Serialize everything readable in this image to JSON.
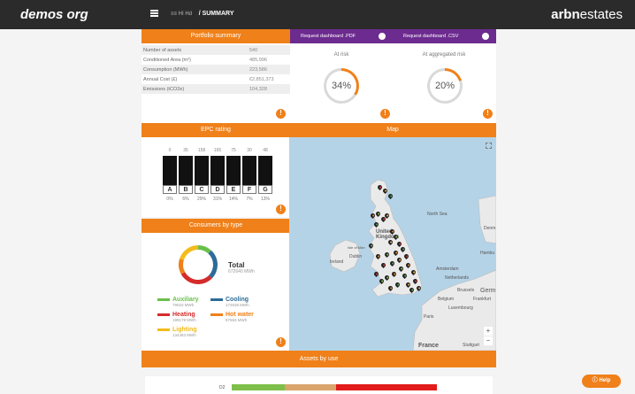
{
  "topbar": {
    "brand": "demos org",
    "crumb_prefix": "≡≡  HI Hd",
    "crumb_current": "/ SUMMARY",
    "logo_bold": "arbn",
    "logo_rest": "estates"
  },
  "portfolio": {
    "title": "Portfolio summary",
    "rows": [
      {
        "label": "Number of assets",
        "value": "540"
      },
      {
        "label": "Conditioned Area (m²)",
        "value": "485,996"
      },
      {
        "label": "Consumption (MWh)",
        "value": "223,586"
      },
      {
        "label": "Annual Cost (£)",
        "value": "€2,851,373"
      },
      {
        "label": "Emissions (tCO2e)",
        "value": "104,328"
      }
    ]
  },
  "request": {
    "pdf_label": "Request dashboard .PDF",
    "csv_label": "Request dashboard .CSV"
  },
  "at_risk": {
    "label": "At risk",
    "percent": 34,
    "percent_text": "34%"
  },
  "aggregated_risk": {
    "label": "At aggregated risk",
    "percent": 20,
    "percent_text": "20%"
  },
  "epc": {
    "title": "EPC rating",
    "bands": [
      {
        "letter": "A",
        "count": "0",
        "pct": "0%",
        "fill": 0.02,
        "color": "#2e8b3a"
      },
      {
        "letter": "B",
        "count": "35",
        "pct": "6%",
        "fill": 0.03,
        "color": "#4caf50"
      },
      {
        "letter": "C",
        "count": "158",
        "pct": "29%",
        "fill": 0.22,
        "color": "#8bc34a"
      },
      {
        "letter": "D",
        "count": "165",
        "pct": "31%",
        "fill": 0.2,
        "color": "#f2e230"
      },
      {
        "letter": "E",
        "count": "75",
        "pct": "14%",
        "fill": 0.1,
        "color": "#f5b945"
      },
      {
        "letter": "F",
        "count": "30",
        "pct": "7%",
        "fill": 0.05,
        "color": "#ef8a2d"
      },
      {
        "letter": "G",
        "count": "48",
        "pct": "13%",
        "fill": 0.1,
        "color": "#e53935"
      }
    ]
  },
  "consumers": {
    "title": "Consumers by type",
    "total_label": "Total",
    "total_value": "672640 MWh",
    "items": [
      {
        "name": "Auxiliary",
        "value": "79023 MWh",
        "color": "#6abf4b"
      },
      {
        "name": "Cooling",
        "value": "172638 MWh",
        "color": "#2d6b99"
      },
      {
        "name": "Heating",
        "value": "199179 MWh",
        "color": "#d62b2b"
      },
      {
        "name": "Hot water",
        "value": "87563 MWh",
        "color": "#f08019"
      },
      {
        "name": "Lighting",
        "value": "134483 MWh",
        "color": "#f3bb1b"
      }
    ]
  },
  "map": {
    "title": "Map",
    "labels": {
      "uk": "United Kingdom",
      "ireland": "Ireland",
      "dublin": "Dublin",
      "north_sea": "North Sea",
      "isle_of_man": "Isle of Man",
      "netherlands": "Netherlands",
      "amsterdam": "Amsterdam",
      "belgium": "Belgium",
      "brussels": "Brussels",
      "germany": "Germ",
      "frankfurt": "Frankfurt",
      "paris": "Paris",
      "luxembourg": "Luxembourg",
      "france": "France",
      "hamburg": "Hambu",
      "denmark": "Denm",
      "stuttgart": "Stuttgart"
    }
  },
  "assets_by_use": {
    "title": "Assets by use",
    "row_label": "D2"
  },
  "help_label": "Help"
}
